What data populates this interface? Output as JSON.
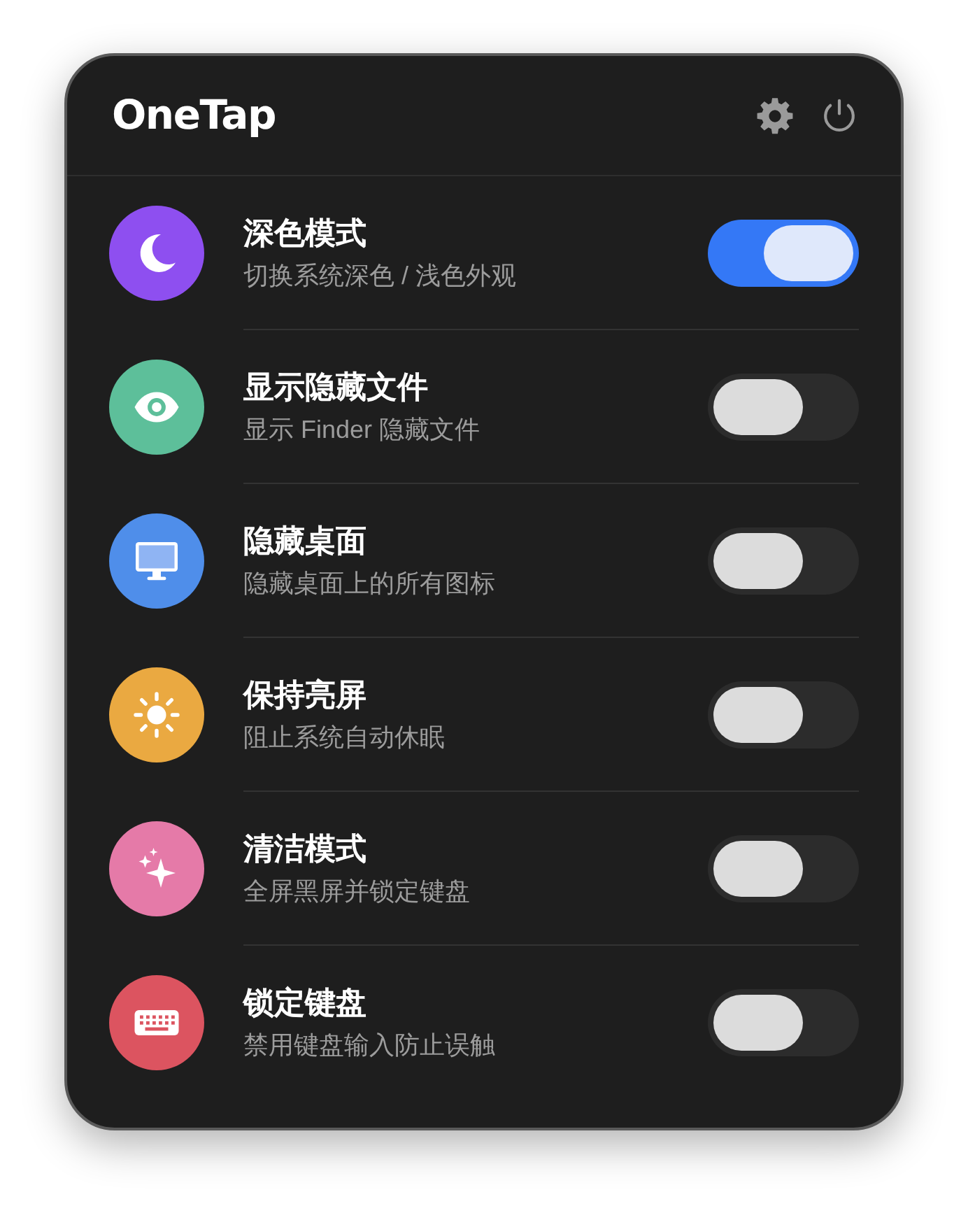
{
  "app": {
    "title": "OneTap"
  },
  "toggles": [
    {
      "title": "深色模式",
      "subtitle": "切换系统深色 / 浅色外观",
      "kind": "moon",
      "color": "#8e4ff0",
      "on": true
    },
    {
      "title": "显示隐藏文件",
      "subtitle": "显示 Finder 隐藏文件",
      "kind": "eye",
      "color": "#5dbf9a",
      "on": false
    },
    {
      "title": "隐藏桌面",
      "subtitle": "隐藏桌面上的所有图标",
      "kind": "monitor",
      "color": "#4f8eea",
      "on": false
    },
    {
      "title": "保持亮屏",
      "subtitle": "阻止系统自动休眠",
      "kind": "sun",
      "color": "#eaa941",
      "on": false
    },
    {
      "title": "清洁模式",
      "subtitle": "全屏黑屏并锁定键盘",
      "kind": "sparkles",
      "color": "#e57aa8",
      "on": false
    },
    {
      "title": "锁定键盘",
      "subtitle": "禁用键盘输入防止误触",
      "kind": "keyboard",
      "color": "#dc5460",
      "on": false
    }
  ]
}
